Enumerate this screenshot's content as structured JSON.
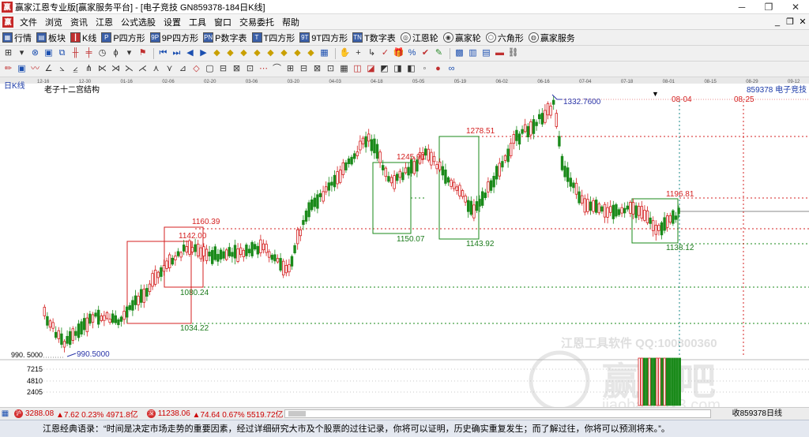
{
  "titlebar": {
    "title": "赢家江恩专业版[赢家服务平台] - [电子竞技  GN859378-184日K线]",
    "minimize": "─",
    "restore": "❐",
    "close": "✕"
  },
  "menu": {
    "items": [
      "文件",
      "浏览",
      "资讯",
      "江恩",
      "公式选股",
      "设置",
      "工具",
      "窗口",
      "交易委托",
      "帮助"
    ],
    "mdi_min": "_",
    "mdi_restore": "❐",
    "mdi_close": "✕"
  },
  "toolbar": {
    "items": [
      {
        "label": "行情",
        "icon": "grid-icon"
      },
      {
        "label": "板块",
        "icon": "blocks-icon"
      },
      {
        "label": "K线",
        "icon": "kline-icon"
      },
      {
        "label": "P四方形",
        "icon": "p-square-icon"
      },
      {
        "label": "9P四方形",
        "icon": "9p-square-icon"
      },
      {
        "label": "P数字表",
        "icon": "p-table-icon"
      },
      {
        "label": "T四方形",
        "icon": "t-square-icon"
      },
      {
        "label": "9T四方形",
        "icon": "9t-square-icon"
      },
      {
        "label": "T数字表",
        "icon": "t-table-icon"
      },
      {
        "label": "江恩轮",
        "icon": "gann-wheel-icon"
      },
      {
        "label": "赢家轮",
        "icon": "winner-wheel-icon"
      },
      {
        "label": "六角形",
        "icon": "hexagon-icon"
      },
      {
        "label": "赢家服务",
        "icon": "service-icon"
      }
    ]
  },
  "chart": {
    "period_label": "日K线",
    "structure_label": "老子十二宫结构",
    "symbol_label": "859378  电子竞技",
    "dates": [
      "12-16",
      "12-30",
      "01-16",
      "02-06",
      "02-20",
      "03-06",
      "03-20",
      "04-03",
      "04-18",
      "05-05",
      "05-19",
      "06-02",
      "06-16",
      "07-04",
      "07-18",
      "08-01",
      "08-15",
      "08-29",
      "09-12"
    ],
    "annotations": {
      "high": "1332.7600",
      "low": "990.5000",
      "low_axis": "990. 5000",
      "p1160": "1160.39",
      "p1142": "1142.00",
      "p1080": "1080.24",
      "p1034": "1034.22",
      "p1245": "1245.91",
      "p1150": "1150.07",
      "p1278": "1278.51",
      "p1143": "1143.92",
      "p1196": "1196.81",
      "p1138": "1138.12",
      "date1": "08-04",
      "date2": "08-25"
    },
    "volume_axis": [
      "7215",
      "4810",
      "2405"
    ],
    "watermark": {
      "line1": "江恩工具软件  QQ:100800360",
      "logo": "赢聊吧",
      "url": "jiaoba.yefx3.com"
    },
    "colors": {
      "up": "#d42020",
      "down": "#1a8a1a",
      "label_red": "#d42020",
      "label_green": "#1a7a1a",
      "label_blue": "#2a35a8"
    }
  },
  "status": {
    "idx1": "3288.08",
    "idx1_change": "▲7.62 0.23% 4971.8亿",
    "idx2": "11238.06",
    "idx2_change": "▲74.64 0.67% 5519.72亿",
    "right_text": "收859378日线"
  },
  "quote": {
    "text": "江恩经典语录：“时间是决定市场走势的重要因素，经过详细研究大市及个股票的过往记录，你将可以证明，历史确实重复发生；而了解过往，你将可以预测将来。”。"
  }
}
